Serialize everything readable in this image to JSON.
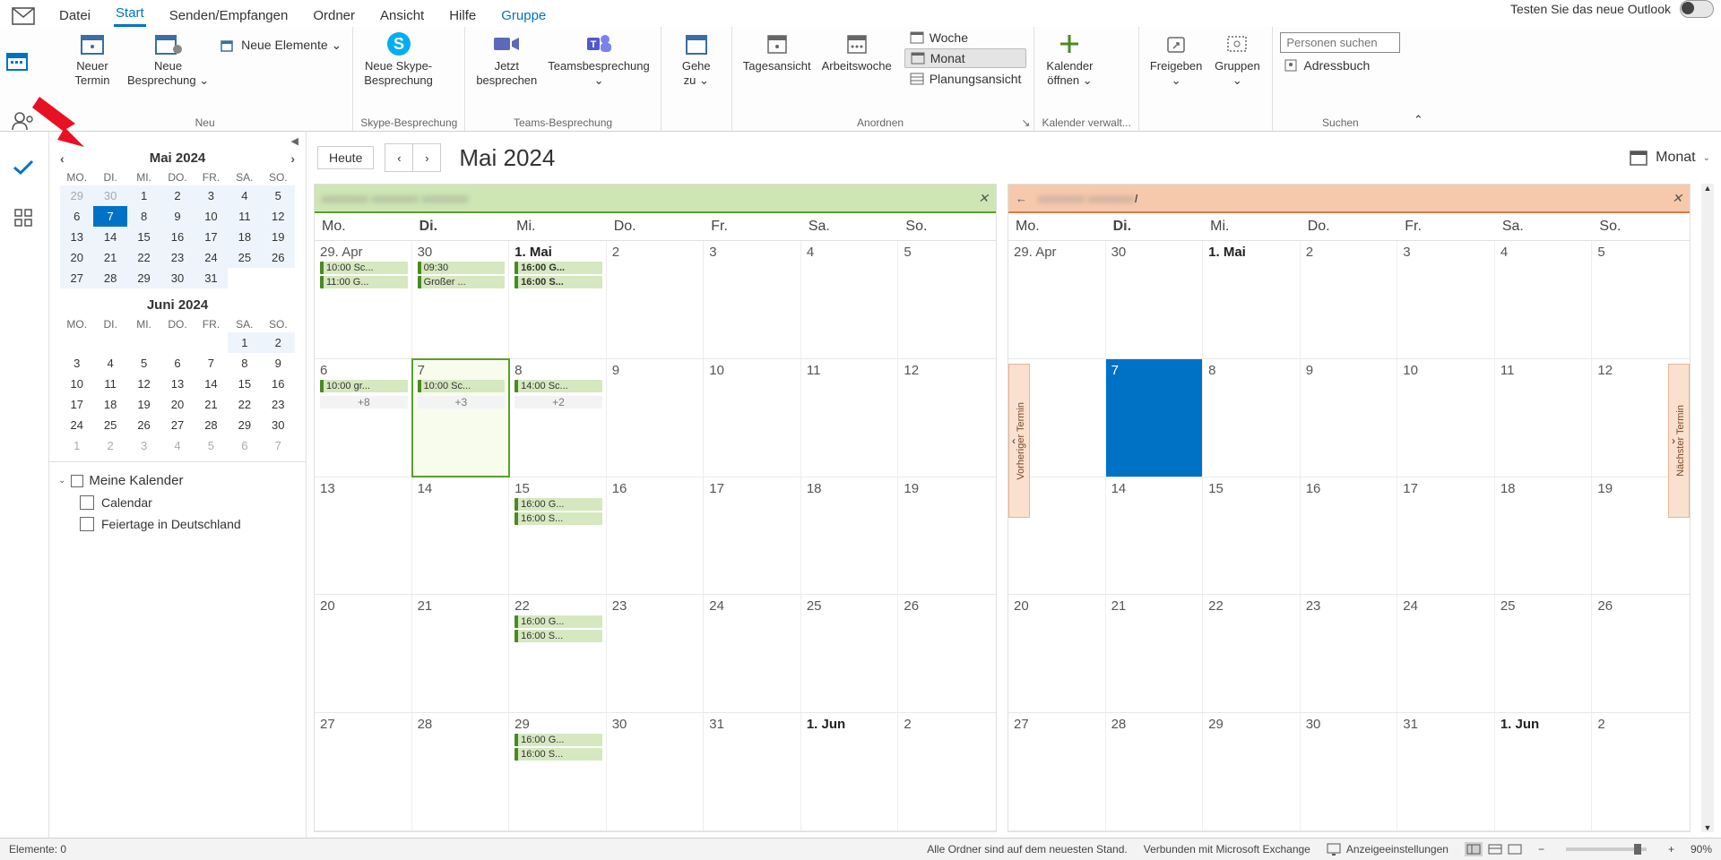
{
  "tabs": {
    "datei": "Datei",
    "start": "Start",
    "senden": "Senden/Empfangen",
    "ordner": "Ordner",
    "ansicht": "Ansicht",
    "hilfe": "Hilfe",
    "gruppe": "Gruppe"
  },
  "toggle_label": "Testen Sie das neue Outlook",
  "ribbon": {
    "neu": {
      "caption": "Neu",
      "neuer_termin": "Neuer\nTermin",
      "neue_besprechung": "Neue\nBesprechung ⌄",
      "neue_elemente": "Neue Elemente ⌄"
    },
    "skype": {
      "caption": "Skype-Besprechung",
      "btn": "Neue Skype-\nBesprechung"
    },
    "teams": {
      "caption": "Teams-Besprechung",
      "jetzt": "Jetzt\nbesprechen",
      "teams": "Teamsbesprechung\n⌄"
    },
    "gehe": {
      "btn": "Gehe\nzu ⌄"
    },
    "anordnen": {
      "caption": "Anordnen",
      "tag": "Tagesansicht",
      "aw": "Arbeitswoche",
      "woche": "Woche",
      "monat": "Monat",
      "plan": "Planungsansicht"
    },
    "verwalten": {
      "caption": "Kalender verwalt...",
      "open": "Kalender\nöffnen ⌄"
    },
    "freigeben": {
      "btn": "Freigeben\n⌄"
    },
    "gruppen": {
      "btn": "Gruppen\n⌄"
    },
    "suchen": {
      "caption": "Suchen",
      "placeholder": "Personen suchen",
      "adress": "Adressbuch"
    }
  },
  "mini": {
    "may": "Mai 2024",
    "jun": "Juni 2024",
    "dh": [
      "MO.",
      "DI.",
      "MI.",
      "DO.",
      "FR.",
      "SA.",
      "SO."
    ],
    "may_days": [
      [
        "29",
        "30",
        "1",
        "2",
        "3",
        "4",
        "5"
      ],
      [
        "6",
        "7",
        "8",
        "9",
        "10",
        "11",
        "12"
      ],
      [
        "13",
        "14",
        "15",
        "16",
        "17",
        "18",
        "19"
      ],
      [
        "20",
        "21",
        "22",
        "23",
        "24",
        "25",
        "26"
      ],
      [
        "27",
        "28",
        "29",
        "30",
        "31",
        "",
        ""
      ]
    ],
    "jun_days": [
      [
        "",
        "",
        "",
        "",
        "",
        "1",
        "2"
      ],
      [
        "3",
        "4",
        "5",
        "6",
        "7",
        "8",
        "9"
      ],
      [
        "10",
        "11",
        "12",
        "13",
        "14",
        "15",
        "16"
      ],
      [
        "17",
        "18",
        "19",
        "20",
        "21",
        "22",
        "23"
      ],
      [
        "24",
        "25",
        "26",
        "27",
        "28",
        "29",
        "30"
      ],
      [
        "1",
        "2",
        "3",
        "4",
        "5",
        "6",
        "7"
      ]
    ]
  },
  "callist": {
    "hdr": "Meine Kalender",
    "c1": "Calendar",
    "c2": "Feiertage in Deutschland"
  },
  "toolbar": {
    "heute": "Heute",
    "title": "Mai 2024",
    "viewpick": "Monat"
  },
  "dayhdr": [
    "Mo.",
    "Di.",
    "Mi.",
    "Do.",
    "Fr.",
    "Sa.",
    "So."
  ],
  "left_weeks": [
    [
      {
        "n": "29. Apr",
        "a": [
          "10:00 Sc...",
          "11:00 G..."
        ]
      },
      {
        "n": "30",
        "a": [
          "09:30",
          "Großer ..."
        ]
      },
      {
        "n": "1. Mai",
        "b": 1,
        "a": [
          "16:00 G...",
          "16:00 S..."
        ]
      },
      {
        "n": "2"
      },
      {
        "n": "3"
      },
      {
        "n": "4"
      },
      {
        "n": "5"
      }
    ],
    [
      {
        "n": "6",
        "a": [
          "10:00 gr..."
        ],
        "m": "+8"
      },
      {
        "n": "7",
        "t": 1,
        "a": [
          "10:00 Sc..."
        ],
        "m": "+3"
      },
      {
        "n": "8",
        "a": [
          "14:00 Sc..."
        ],
        "m": "+2"
      },
      {
        "n": "9"
      },
      {
        "n": "10"
      },
      {
        "n": "11"
      },
      {
        "n": "12"
      }
    ],
    [
      {
        "n": "13"
      },
      {
        "n": "14"
      },
      {
        "n": "15",
        "a": [
          "16:00 G...",
          "16:00 S..."
        ]
      },
      {
        "n": "16"
      },
      {
        "n": "17"
      },
      {
        "n": "18"
      },
      {
        "n": "19"
      }
    ],
    [
      {
        "n": "20"
      },
      {
        "n": "21"
      },
      {
        "n": "22",
        "a": [
          "16:00 G...",
          "16:00 S..."
        ]
      },
      {
        "n": "23"
      },
      {
        "n": "24"
      },
      {
        "n": "25"
      },
      {
        "n": "26"
      }
    ],
    [
      {
        "n": "27"
      },
      {
        "n": "28"
      },
      {
        "n": "29",
        "a": [
          "16:00 G...",
          "16:00 S..."
        ]
      },
      {
        "n": "30"
      },
      {
        "n": "31"
      },
      {
        "n": "1. Jun",
        "b": 1
      },
      {
        "n": "2"
      }
    ]
  ],
  "right_weeks": [
    [
      {
        "n": "29. Apr"
      },
      {
        "n": "30"
      },
      {
        "n": "1. Mai",
        "b": 1
      },
      {
        "n": "2"
      },
      {
        "n": "3"
      },
      {
        "n": "4"
      },
      {
        "n": "5"
      }
    ],
    [
      {
        "n": "6"
      },
      {
        "n": "7",
        "t": 1
      },
      {
        "n": "8"
      },
      {
        "n": "9"
      },
      {
        "n": "10"
      },
      {
        "n": "11"
      },
      {
        "n": "12"
      }
    ],
    [
      {
        "n": "13"
      },
      {
        "n": "14"
      },
      {
        "n": "15"
      },
      {
        "n": "16"
      },
      {
        "n": "17"
      },
      {
        "n": "18"
      },
      {
        "n": "19"
      }
    ],
    [
      {
        "n": "20"
      },
      {
        "n": "21"
      },
      {
        "n": "22"
      },
      {
        "n": "23"
      },
      {
        "n": "24"
      },
      {
        "n": "25"
      },
      {
        "n": "26"
      }
    ],
    [
      {
        "n": "27"
      },
      {
        "n": "28"
      },
      {
        "n": "29"
      },
      {
        "n": "30"
      },
      {
        "n": "31"
      },
      {
        "n": "1. Jun",
        "b": 1
      },
      {
        "n": "2"
      }
    ]
  ],
  "handles": {
    "prev": "Vorheriger Termin",
    "next": "Nächster Termin"
  },
  "status": {
    "elemente": "Elemente: 0",
    "sync": "Alle Ordner sind auf dem neuesten Stand.",
    "conn": "Verbunden mit Microsoft Exchange",
    "anz": "Anzeigeeinstellungen",
    "zoom": "90%"
  }
}
